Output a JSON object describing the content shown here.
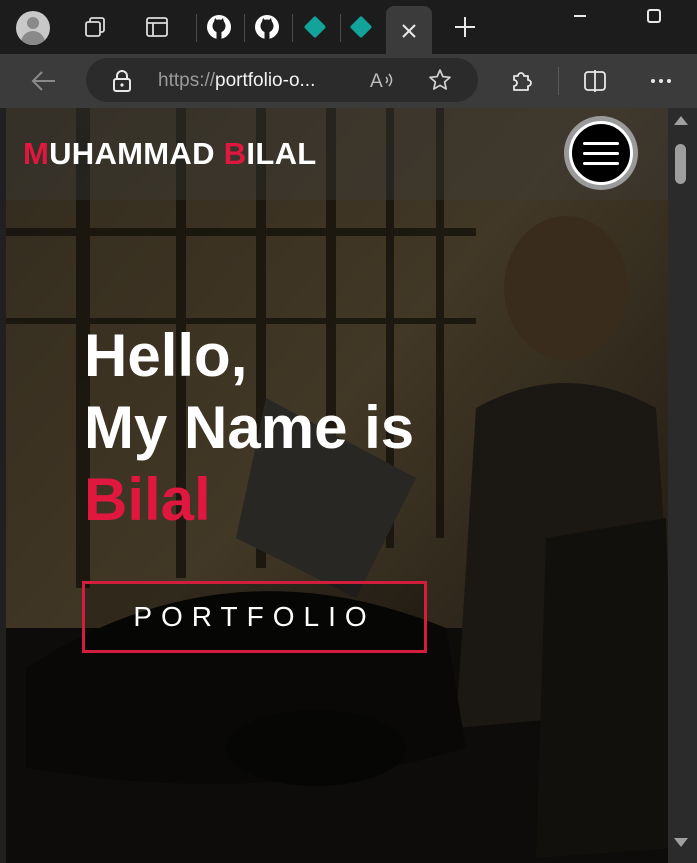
{
  "browser": {
    "tabs": [
      {
        "icon": "workspaces-icon"
      },
      {
        "icon": "tab-actions-icon"
      },
      {
        "icon": "github-icon"
      },
      {
        "icon": "github-icon"
      },
      {
        "icon": "diamond-site-icon"
      },
      {
        "icon": "diamond-site-icon"
      },
      {
        "icon": "close-icon",
        "active": true
      }
    ],
    "new_tab_icon": "plus-icon",
    "address": {
      "scheme": "https://",
      "host_visible": "portfolio-o..."
    },
    "toolbar_icons": [
      "back-arrow-icon",
      "lock-icon",
      "read-aloud-icon",
      "favorite-star-icon",
      "extensions-icon",
      "split-screen-icon",
      "more-options-icon"
    ]
  },
  "site": {
    "logo_first_initial": "M",
    "logo_first_rest": "UHAMMAD",
    "logo_last_initial": "B",
    "logo_last_rest": "ILAL",
    "hero_line1": "Hello,",
    "hero_line2": "My Name is",
    "hero_name": "Bilal",
    "cta_label": "PORTFOLIO",
    "menu_icon": "hamburger-menu-icon"
  },
  "colors": {
    "accent": "#e0173f",
    "cta_border": "#d21d3d",
    "chrome_bg": "#1c1c1c",
    "toolbar_bg": "#3b3b3b"
  }
}
